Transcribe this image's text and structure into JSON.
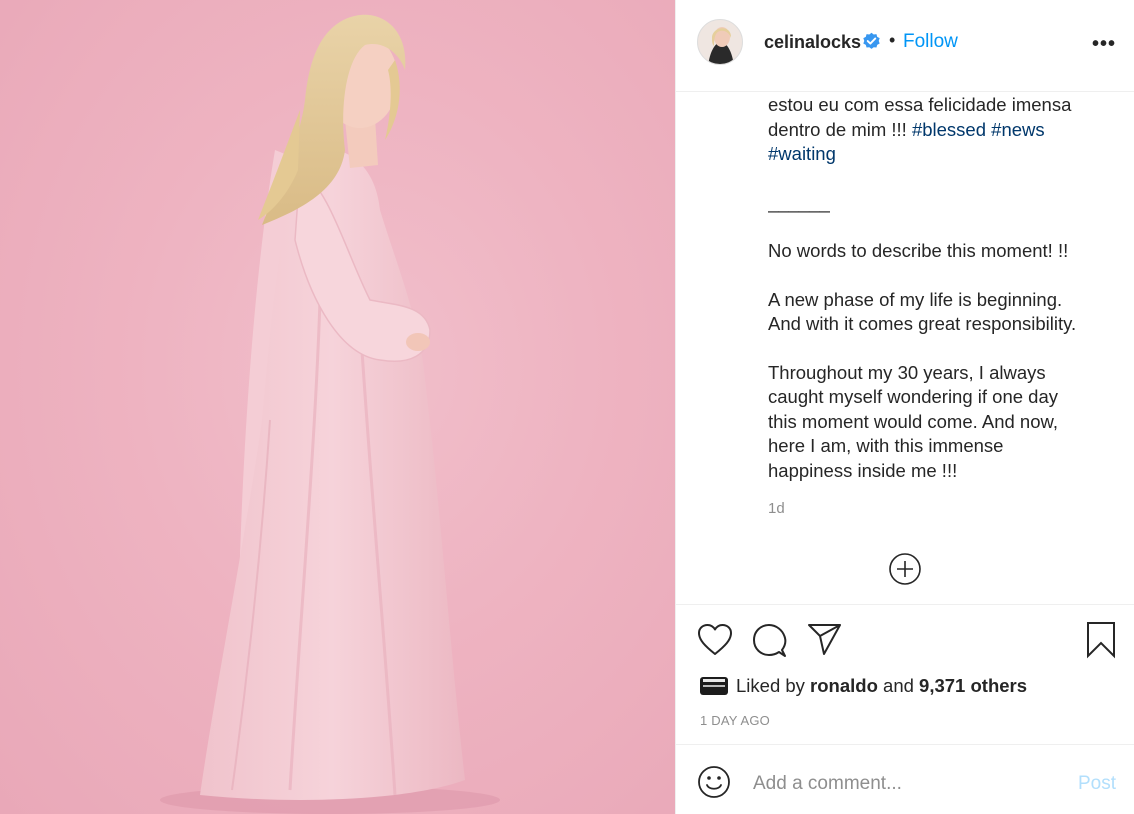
{
  "post": {
    "username": "celinalocks",
    "separator": "•",
    "follow_label": "Follow",
    "more_label": "•••"
  },
  "caption": {
    "line1": "estou eu com essa felicidade imensa",
    "line2_text": "dentro de mim !!! ",
    "tag1": "#blessed",
    "tag2": "#news",
    "tag3": "#waiting",
    "divider": "______",
    "p1": "No words to describe this moment! !!",
    "p2": "A new phase of my life is beginning.\nAnd with it comes great responsibility.",
    "p3": "Throughout my 30 years, I always\ncaught myself wondering if one day\nthis moment would come. And now,\nhere I am, with this immense\nhappiness inside me !!!",
    "time_relative": "1d"
  },
  "likes": {
    "prefix": "Liked by ",
    "liker": "ronaldo",
    "and": " and ",
    "count": "9,371 others"
  },
  "date_label": "1 DAY AGO",
  "comment": {
    "placeholder": "Add a comment...",
    "post_label": "Post"
  },
  "colors": {
    "accent": "#0095f6",
    "hashtag": "#00376b",
    "muted": "#8e8e8e",
    "post_disabled": "#b2dffc",
    "background_pink": "#eeb3c1"
  },
  "icons": [
    "verified-badge-icon",
    "more-options-icon",
    "load-more-comments-icon",
    "heart-icon",
    "comment-icon",
    "share-icon",
    "bookmark-icon",
    "emoji-icon"
  ]
}
